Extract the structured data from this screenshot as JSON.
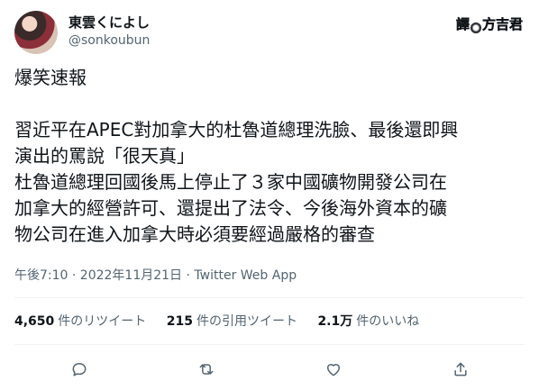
{
  "author": {
    "display_name": "東雲くによし",
    "handle": "@sonkoubun"
  },
  "watermark": {
    "prefix": "譯",
    "name": "方吉君"
  },
  "tweet": {
    "lines": [
      "爆笑速報",
      "",
      "習近平在APEC對加拿大的杜魯道總理洗臉、最後還即興",
      "演出的罵說「很天真」",
      "杜魯道總理回國後馬上停止了３家中國礦物開發公司在",
      "加拿大的經營許可、還提出了法令、今後海外資本的礦",
      "物公司在進入加拿大時必須要經過嚴格的審查"
    ],
    "timestamp": "午後7:10 · 2022年11月21日 · Twitter Web App"
  },
  "stats": {
    "retweets_count": "4,650",
    "retweets_label": "件のリツイート",
    "quotes_count": "215",
    "quotes_label": "件の引用ツイート",
    "likes_count": "2.1万",
    "likes_label": "件のいいね"
  },
  "icons": {
    "reply": "reply-icon",
    "retweet": "retweet-icon",
    "like": "heart-icon",
    "share": "share-icon"
  },
  "colors": {
    "text": "#0f1419",
    "secondary": "#536471",
    "divider": "#eff3f4"
  }
}
